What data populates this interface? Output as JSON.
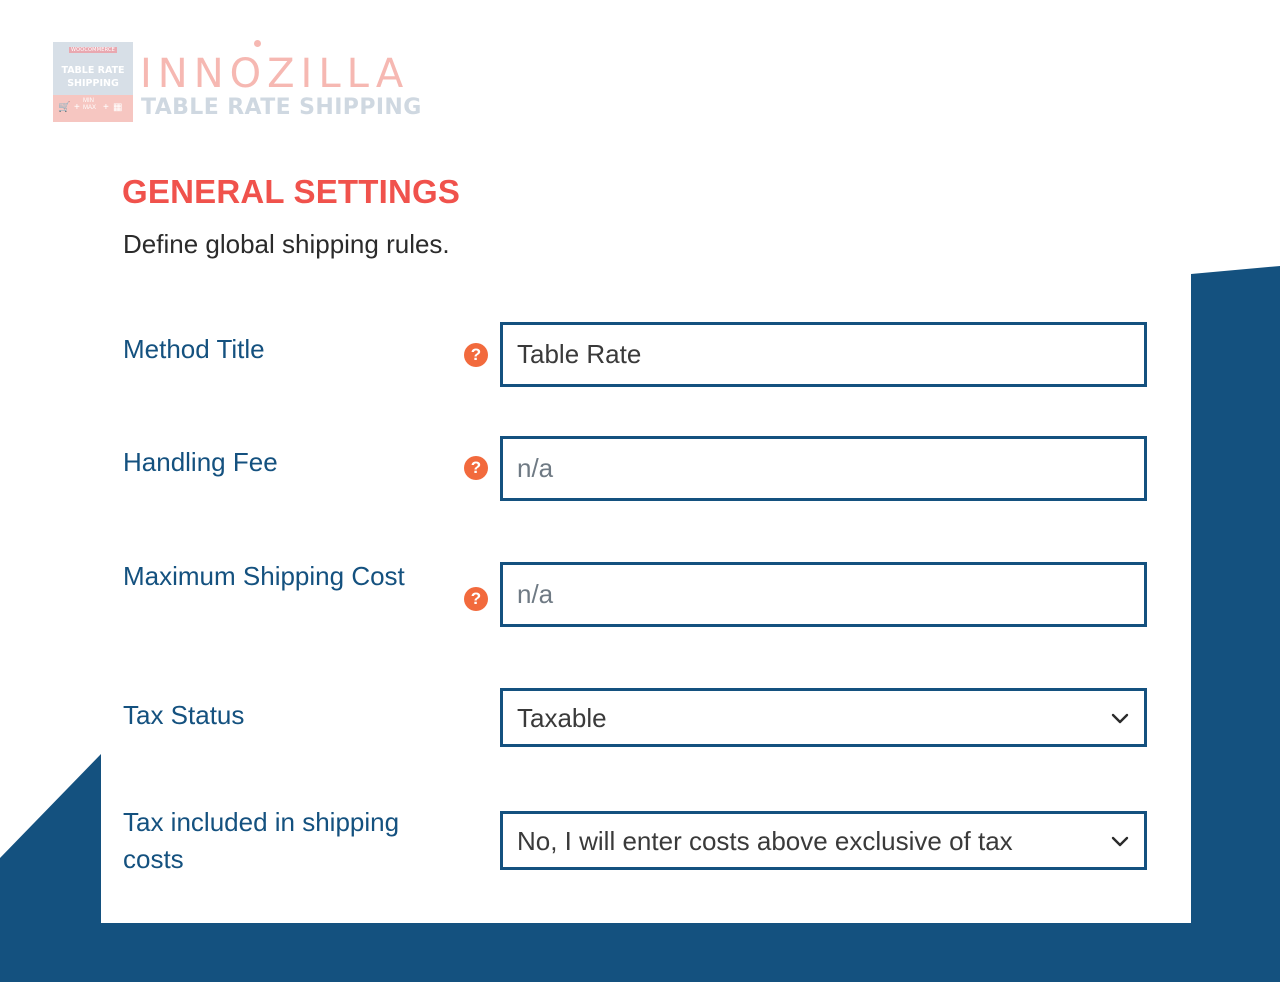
{
  "brand": {
    "badge_top": "WOOCOMMERCE",
    "badge_title_line1": "TABLE RATE",
    "badge_title_line2": "SHIPPING",
    "badge_min": "MIN",
    "badge_max": "MAX",
    "name": "INNOZILLA",
    "subtitle": "TABLE RATE SHIPPING"
  },
  "section": {
    "title": "GENERAL SETTINGS",
    "description": "Define global shipping rules."
  },
  "form": {
    "method_title": {
      "label": "Method Title",
      "value": "Table Rate"
    },
    "handling_fee": {
      "label": "Handling Fee",
      "placeholder": "n/a"
    },
    "max_shipping_cost": {
      "label": "Maximum Shipping Cost",
      "placeholder": "n/a"
    },
    "tax_status": {
      "label": "Tax Status",
      "selected": "Taxable"
    },
    "tax_included": {
      "label": "Tax included in shipping costs",
      "selected": "No, I will enter costs above exclusive of tax"
    }
  },
  "icons": {
    "help": "question-circle-icon",
    "dropdown": "chevron-down-icon"
  },
  "colors": {
    "accent_title": "#f0524c",
    "label_blue": "#14517f",
    "field_border": "#14517f",
    "help_icon": "#f26a3d",
    "background_shape": "#14517f"
  }
}
